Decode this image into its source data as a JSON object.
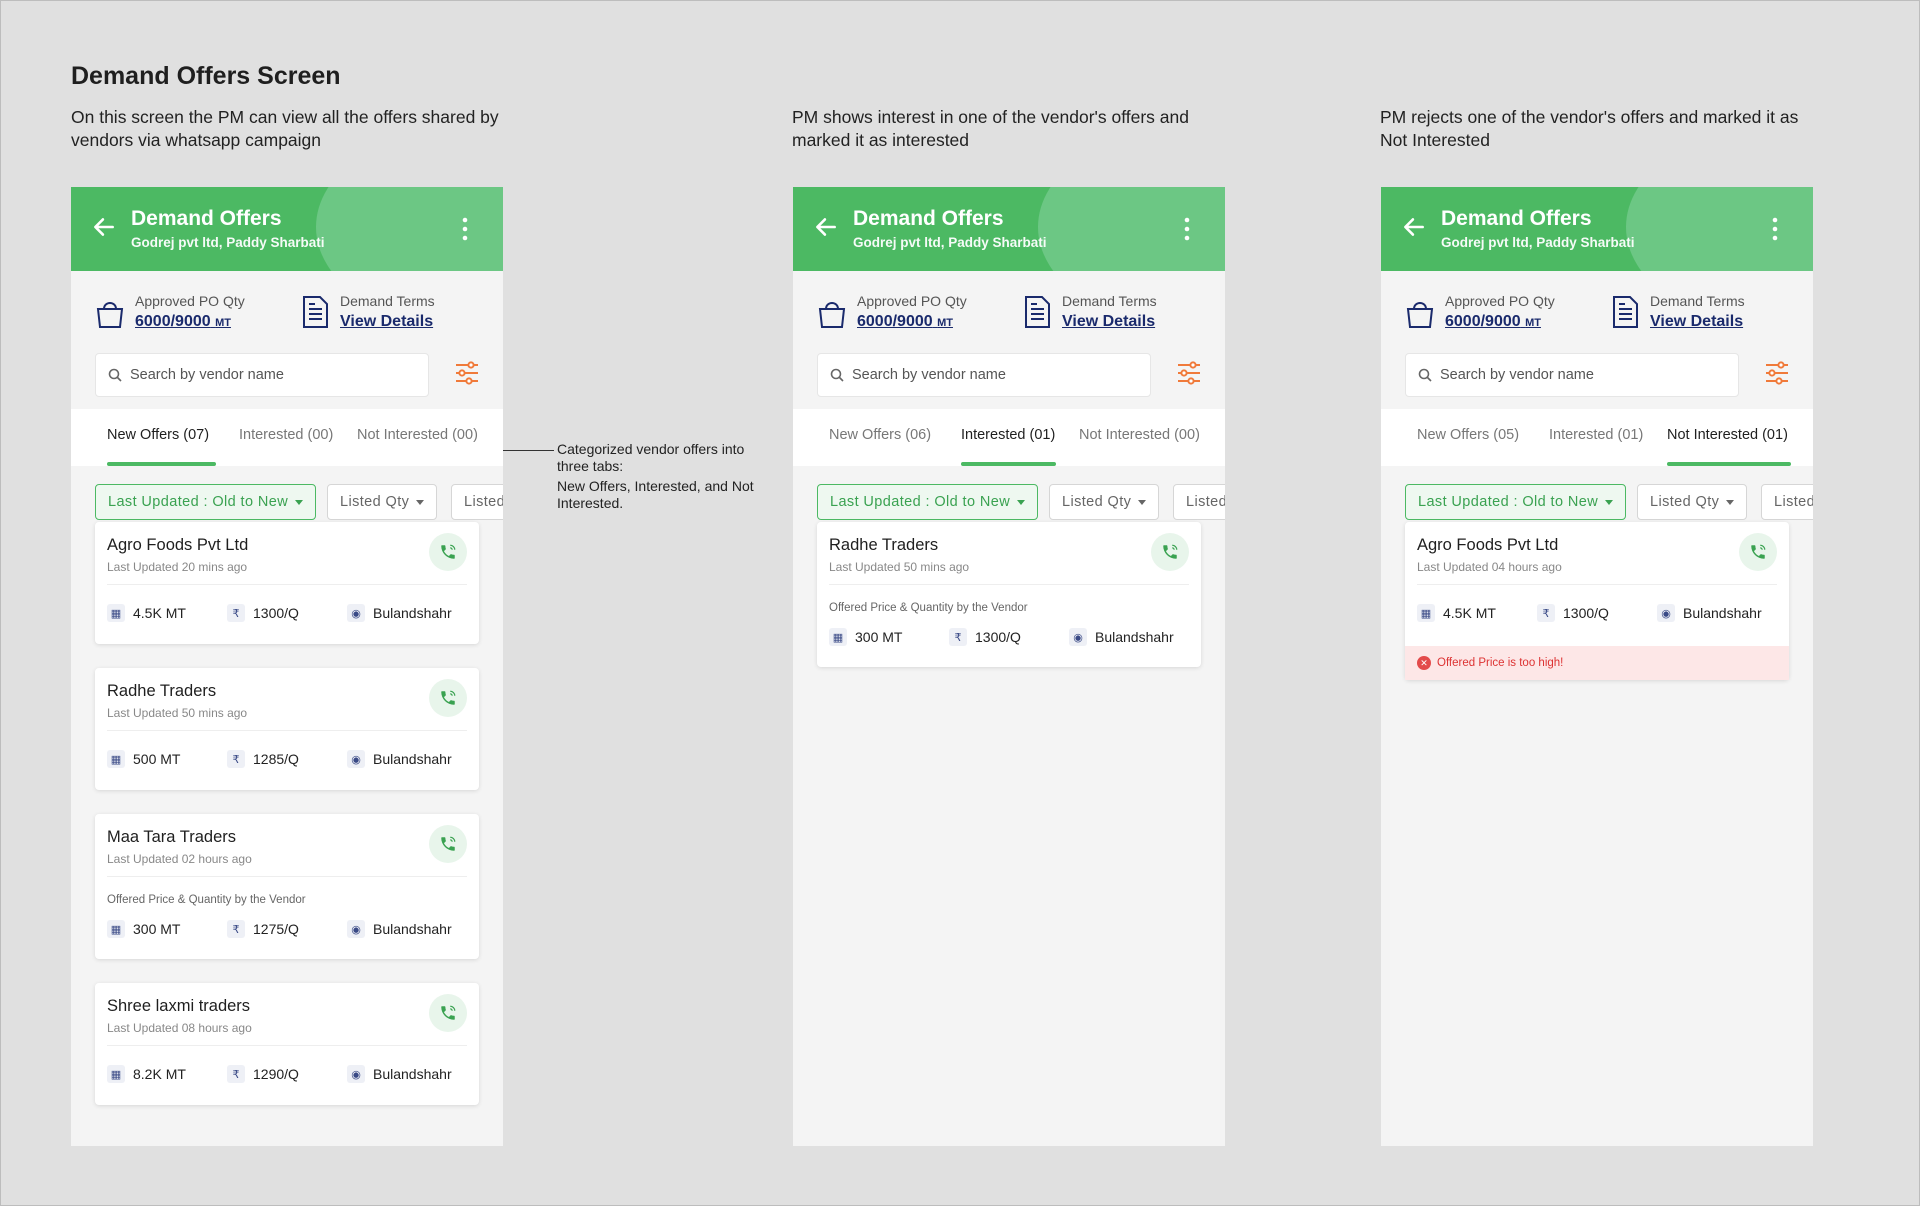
{
  "page": {
    "heading": "Demand Offers Screen",
    "desc1": "On this screen the PM can view all the offers shared by vendors via whatsapp campaign",
    "desc2": "PM shows interest in one of the vendor's offers and marked it as interested",
    "desc3": "PM rejects one of the vendor's offers and marked it as Not Interested"
  },
  "annotation": {
    "line1": "Categorized vendor offers into three tabs:",
    "line2": "New Offers, Interested, and Not Interested."
  },
  "common": {
    "title": "Demand Offers",
    "subtitle": "Godrej pvt ltd, Paddy Sharbati",
    "po_label": "Approved PO Qty",
    "po_value": "6000/9000",
    "po_unit": "MT",
    "terms_label": "Demand Terms",
    "terms_link": "View Details",
    "search_placeholder": "Search by vendor name",
    "chip_sort": "Last Updated : Old to New",
    "chip_qty": "Listed Qty",
    "chip_more": "Listed",
    "offer_note": "Offered Price & Quantity by the Vendor"
  },
  "screens": [
    {
      "tabs": [
        "New Offers (07)",
        "Interested (00)",
        "Not Interested (00)"
      ],
      "active_tab": 0,
      "cards": [
        {
          "name": "Agro Foods Pvt Ltd",
          "time": "Last Updated 20 mins ago",
          "qty": "4.5K MT",
          "price": "1300/Q",
          "loc": "Bulandshahr"
        },
        {
          "name": "Radhe Traders",
          "time": "Last Updated 50 mins ago",
          "qty": "500 MT",
          "price": "1285/Q",
          "loc": "Bulandshahr"
        },
        {
          "name": "Maa Tara Traders",
          "time": "Last Updated 02 hours ago",
          "qty": "300 MT",
          "price": "1275/Q",
          "loc": "Bulandshahr"
        },
        {
          "name": "Shree laxmi traders",
          "time": "Last Updated 08 hours ago",
          "qty": "8.2K MT",
          "price": "1290/Q",
          "loc": "Bulandshahr"
        }
      ]
    },
    {
      "tabs": [
        "New Offers (06)",
        "Interested (01)",
        "Not Interested (00)"
      ],
      "active_tab": 1,
      "cards": [
        {
          "name": "Radhe Traders",
          "time": "Last Updated 50 mins ago",
          "qty": "300 MT",
          "price": "1300/Q",
          "loc": "Bulandshahr"
        }
      ]
    },
    {
      "tabs": [
        "New Offers (05)",
        "Interested (01)",
        "Not Interested (01)"
      ],
      "active_tab": 2,
      "cards": [
        {
          "name": "Agro Foods Pvt Ltd",
          "time": "Last Updated 04 hours ago",
          "qty": "4.5K MT",
          "price": "1300/Q",
          "loc": "Bulandshahr",
          "reject": "Offered Price is too high!"
        }
      ]
    }
  ],
  "colors": {
    "brand": "#4cb963",
    "link": "#1a2a6c",
    "accent": "#f07a3a",
    "error": "#e34b4b"
  }
}
